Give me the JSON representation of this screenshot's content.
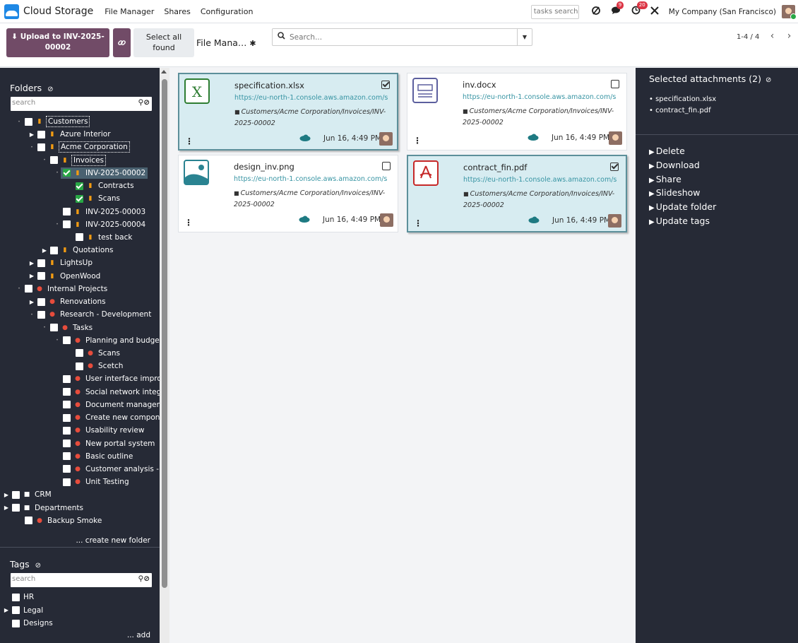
{
  "app": {
    "name": "Cloud Storage",
    "menu": [
      "File Manager",
      "Shares",
      "Configuration"
    ],
    "tasks_search_placeholder": "tasks search",
    "badges": {
      "messages": "9",
      "activities": "20"
    },
    "company": "My Company (San Francisco)"
  },
  "control": {
    "upload_label_line1": "⬇ Upload to INV-2025-",
    "upload_label_line2": "00002",
    "link_icon": "🔗",
    "select_all_line1": "Select all",
    "select_all_line2": "found",
    "breadcrumb": "File Mana…",
    "search_placeholder": "Search...",
    "pager": "1-4 / 4"
  },
  "folders": {
    "title": "Folders",
    "search_placeholder": "search",
    "create_label": "... create new folder",
    "rows": [
      {
        "label": "Customers",
        "lvl": 0,
        "exp": "dot",
        "icon": "orange",
        "boxed": true
      },
      {
        "label": "Azure Interior",
        "lvl": 1,
        "exp": "caret",
        "icon": "orange"
      },
      {
        "label": "Acme Corporation",
        "lvl": 1,
        "exp": "dot",
        "icon": "orange",
        "boxed": true
      },
      {
        "label": "Invoices",
        "lvl": 2,
        "exp": "dot",
        "icon": "orange",
        "boxed": true
      },
      {
        "label": "INV-2025-00002",
        "lvl": 3,
        "exp": "dot",
        "icon": "orange",
        "checked": true,
        "selected": true
      },
      {
        "label": "Contracts",
        "lvl": 4,
        "exp": "none",
        "icon": "orange",
        "checked": true
      },
      {
        "label": "Scans",
        "lvl": 4,
        "exp": "none",
        "icon": "orange",
        "checked": true
      },
      {
        "label": "INV-2025-00003",
        "lvl": 3,
        "exp": "none",
        "icon": "orange"
      },
      {
        "label": "INV-2025-00004",
        "lvl": 3,
        "exp": "dot",
        "icon": "orange"
      },
      {
        "label": "test back",
        "lvl": 4,
        "exp": "none",
        "icon": "orange"
      },
      {
        "label": "Quotations",
        "lvl": 2,
        "exp": "caret",
        "icon": "orange"
      },
      {
        "label": "LightsUp",
        "lvl": 1,
        "exp": "caret",
        "icon": "orange"
      },
      {
        "label": "OpenWood",
        "lvl": 1,
        "exp": "caret",
        "icon": "orange"
      },
      {
        "label": "Internal Projects",
        "lvl": 0,
        "exp": "dot",
        "icon": "red"
      },
      {
        "label": "Renovations",
        "lvl": 1,
        "exp": "caret",
        "icon": "red"
      },
      {
        "label": "Research - Development",
        "lvl": 1,
        "exp": "dot",
        "icon": "red"
      },
      {
        "label": "Tasks",
        "lvl": 2,
        "exp": "dot",
        "icon": "red"
      },
      {
        "label": "Planning and budget",
        "lvl": 3,
        "exp": "dot",
        "icon": "red"
      },
      {
        "label": "Scans",
        "lvl": 4,
        "exp": "none",
        "icon": "red"
      },
      {
        "label": "Scetch",
        "lvl": 4,
        "exp": "none",
        "icon": "red"
      },
      {
        "label": "User interface improvem",
        "lvl": 3,
        "exp": "none",
        "icon": "red"
      },
      {
        "label": "Social network integratio",
        "lvl": 3,
        "exp": "none",
        "icon": "red"
      },
      {
        "label": "Document management",
        "lvl": 3,
        "exp": "none",
        "icon": "red"
      },
      {
        "label": "Create new components",
        "lvl": 3,
        "exp": "none",
        "icon": "red"
      },
      {
        "label": "Usability review",
        "lvl": 3,
        "exp": "none",
        "icon": "red"
      },
      {
        "label": "New portal system",
        "lvl": 3,
        "exp": "none",
        "icon": "red"
      },
      {
        "label": "Basic outline",
        "lvl": 3,
        "exp": "none",
        "icon": "red"
      },
      {
        "label": "Customer analysis - Arch",
        "lvl": 3,
        "exp": "none",
        "icon": "red"
      },
      {
        "label": "Unit Testing",
        "lvl": 3,
        "exp": "none",
        "icon": "red"
      },
      {
        "label": "CRM",
        "lvl": -1,
        "exp": "caret",
        "icon": "white"
      },
      {
        "label": "Departments",
        "lvl": -1,
        "exp": "caret",
        "icon": "white"
      },
      {
        "label": "Backup Smoke",
        "lvl": 0,
        "exp": "none",
        "icon": "red"
      }
    ]
  },
  "tags": {
    "title": "Tags",
    "search_placeholder": "search",
    "add_label": "... add",
    "rows": [
      {
        "label": "HR",
        "exp": "none"
      },
      {
        "label": "Legal",
        "exp": "caret"
      },
      {
        "label": "Designs",
        "exp": "none"
      }
    ]
  },
  "files": [
    {
      "name": "specification.xlsx",
      "type": "xlsx",
      "url": "https://eu-north-1.console.aws.amazon.com/s",
      "path": "Customers/Acme Corporation/Invoices/INV-2025-00002",
      "date": "Jun 16, 4:49 PM",
      "checked": true
    },
    {
      "name": "inv.docx",
      "type": "docx",
      "url": "https://eu-north-1.console.aws.amazon.com/s",
      "path": "Customers/Acme Corporation/Invoices/INV-2025-00002",
      "date": "Jun 16, 4:49 PM",
      "checked": false
    },
    {
      "name": "design_inv.png",
      "type": "png",
      "url": "https://eu-north-1.console.aws.amazon.com/s",
      "path": "Customers/Acme Corporation/Invoices/INV-2025-00002",
      "date": "Jun 16, 4:49 PM",
      "checked": false
    },
    {
      "name": "contract_fin.pdf",
      "type": "pdf",
      "url": "https://eu-north-1.console.aws.amazon.com/s",
      "path": "Customers/Acme Corporation/Invoices/INV-2025-00002",
      "date": "Jun 16, 4:49 PM",
      "checked": true
    }
  ],
  "selected_panel": {
    "title": "Selected attachments (2)",
    "items": [
      "specification.xlsx",
      "contract_fin.pdf"
    ],
    "actions": [
      "Delete",
      "Download",
      "Share",
      "Slideshow",
      "Update folder",
      "Update tags"
    ]
  },
  "colors": {
    "primary": "#714b67",
    "panel": "#262a36",
    "link": "#3794a3",
    "selected_card": "#d7ecf1"
  }
}
